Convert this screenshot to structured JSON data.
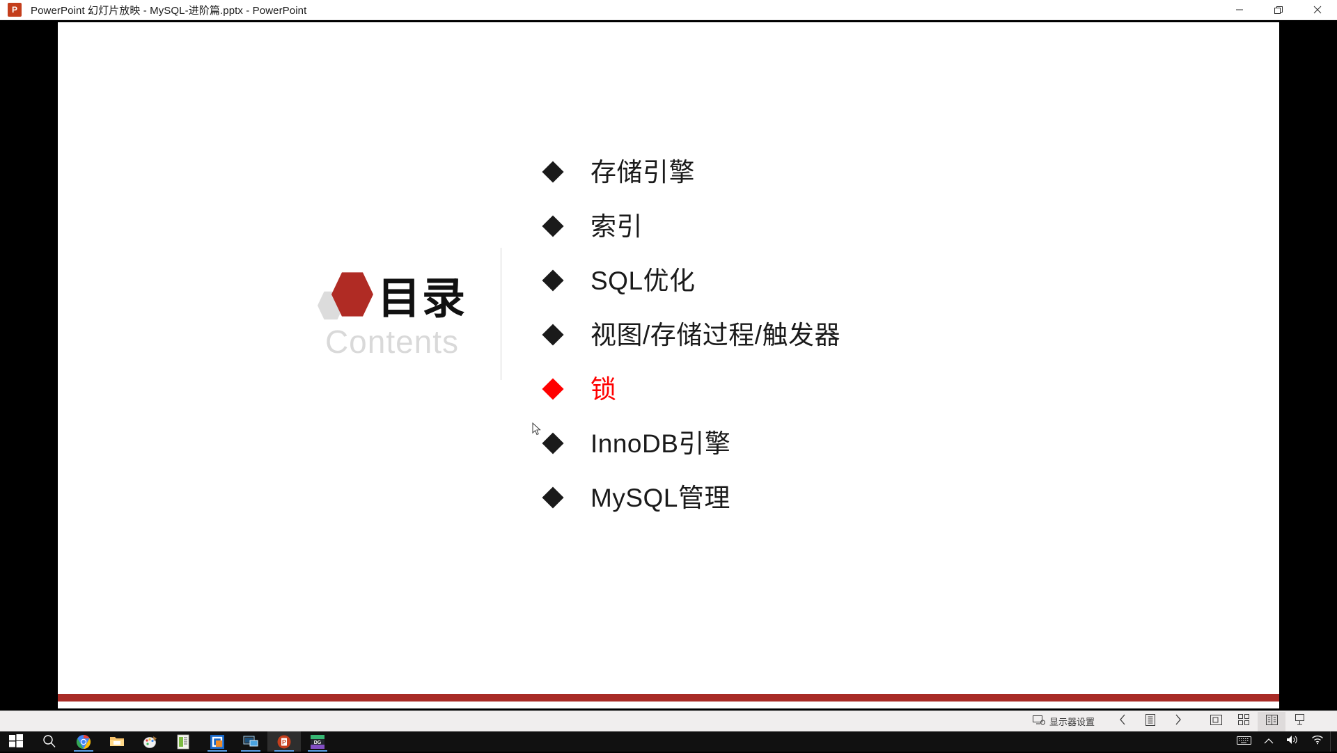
{
  "window": {
    "app_icon": "powerpoint-icon",
    "title": "PowerPoint 幻灯片放映  -  MySQL-进阶篇.pptx - PowerPoint",
    "controls": {
      "minimize": "minimize-button",
      "restore": "restore-button",
      "close": "close-button"
    }
  },
  "slide": {
    "logo": {
      "big_hex_color": "#b02b24",
      "small_hex_color": "#dcdcdc"
    },
    "heading_cn": "目录",
    "heading_en": "Contents",
    "accent_color": "#a82b26",
    "active_color": "#ff0000",
    "items": [
      {
        "label": "存储引擎",
        "active": false
      },
      {
        "label": "索引",
        "active": false
      },
      {
        "label": "SQL优化",
        "active": false
      },
      {
        "label": "视图/存储过程/触发器",
        "active": false
      },
      {
        "label": "锁",
        "active": true
      },
      {
        "label": "InnoDB引擎",
        "active": false
      },
      {
        "label": "MySQL管理",
        "active": false
      }
    ]
  },
  "statusbar": {
    "monitor_settings_label": "显示器设置",
    "monitor_settings_icon": "monitor-icon",
    "previous_icon": "chevron-left-icon",
    "pen_menu_icon": "slide-menu-icon",
    "next_icon": "chevron-right-icon",
    "zoom_icon": "magnify-slide-icon",
    "all_slides_icon": "grid-slides-icon",
    "reading_view_icon": "reading-view-icon",
    "presenter_view_icon": "presenter-view-icon"
  },
  "taskbar": {
    "items": [
      {
        "name": "start-button",
        "icon": "windows-logo-icon",
        "running": false,
        "active": false
      },
      {
        "name": "search-button",
        "icon": "search-icon",
        "running": false,
        "active": false
      },
      {
        "name": "chrome-button",
        "icon": "chrome-icon",
        "running": true,
        "active": false
      },
      {
        "name": "file-explorer-button",
        "icon": "folder-icon",
        "running": false,
        "active": false
      },
      {
        "name": "paint-button",
        "icon": "paint-icon",
        "running": false,
        "active": false
      },
      {
        "name": "notepad-button",
        "icon": "document-icon",
        "running": false,
        "active": false
      },
      {
        "name": "office-app-button",
        "icon": "office-square-icon",
        "running": true,
        "active": false
      },
      {
        "name": "remote-desktop-button",
        "icon": "monitor-icon",
        "running": true,
        "active": false
      },
      {
        "name": "powerpoint-button",
        "icon": "powerpoint-icon",
        "running": true,
        "active": true
      },
      {
        "name": "datagrip-button",
        "icon": "datagrip-icon",
        "running": true,
        "active": false
      }
    ],
    "tray": [
      {
        "name": "touch-keyboard-button",
        "icon": "keyboard-icon"
      },
      {
        "name": "show-hidden-icons-button",
        "icon": "chevron-up-icon"
      },
      {
        "name": "volume-button",
        "icon": "speaker-icon"
      },
      {
        "name": "network-button",
        "icon": "wifi-icon"
      }
    ]
  }
}
